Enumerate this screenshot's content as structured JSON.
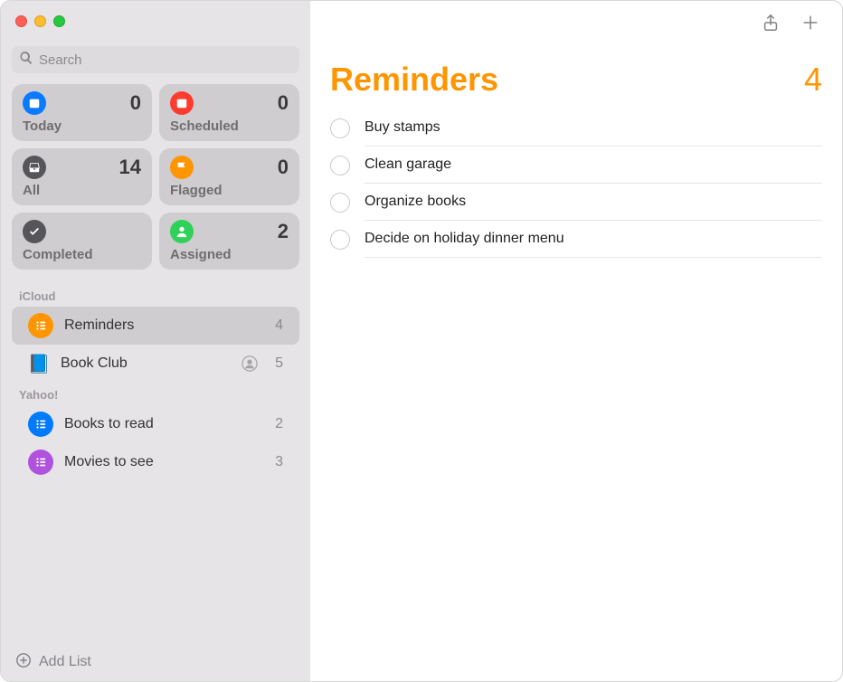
{
  "sidebar": {
    "search_placeholder": "Search",
    "smart": [
      {
        "key": "today",
        "label": "Today",
        "count": "0",
        "color": "bg-blue",
        "icon": "calendar"
      },
      {
        "key": "scheduled",
        "label": "Scheduled",
        "count": "0",
        "color": "bg-red",
        "icon": "calendar"
      },
      {
        "key": "all",
        "label": "All",
        "count": "14",
        "color": "bg-dark",
        "icon": "tray"
      },
      {
        "key": "flagged",
        "label": "Flagged",
        "count": "0",
        "color": "bg-orange",
        "icon": "flag"
      },
      {
        "key": "completed",
        "label": "Completed",
        "count": "",
        "color": "bg-dark",
        "icon": "check"
      },
      {
        "key": "assigned",
        "label": "Assigned",
        "count": "2",
        "color": "bg-green",
        "icon": "person"
      }
    ],
    "sections": [
      {
        "title": "iCloud",
        "lists": [
          {
            "name": "Reminders",
            "count": "4",
            "color": "bg-orange",
            "icon": "bullets",
            "shared": false,
            "selected": true
          },
          {
            "name": "Book Club",
            "count": "5",
            "color": "book",
            "icon": "book",
            "shared": true,
            "selected": false
          }
        ]
      },
      {
        "title": "Yahoo!",
        "lists": [
          {
            "name": "Books to read",
            "count": "2",
            "color": "bg-blue2",
            "icon": "bullets",
            "shared": false,
            "selected": false
          },
          {
            "name": "Movies to see",
            "count": "3",
            "color": "bg-purple",
            "icon": "bullets",
            "shared": false,
            "selected": false
          }
        ]
      }
    ],
    "add_list_label": "Add List"
  },
  "main": {
    "title": "Reminders",
    "count": "4",
    "items": [
      "Buy stamps",
      "Clean garage",
      "Organize books",
      "Decide on holiday dinner menu"
    ]
  }
}
